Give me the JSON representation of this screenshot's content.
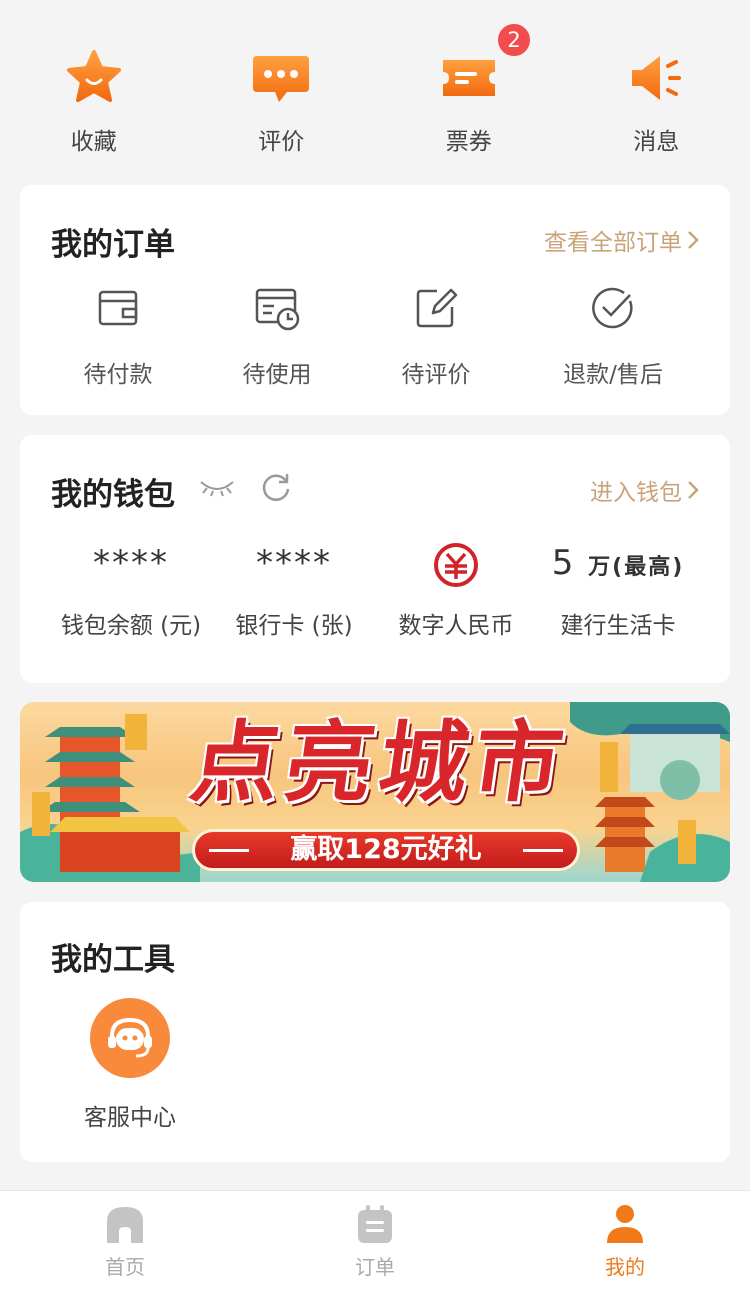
{
  "quick_actions": [
    {
      "label": "收藏",
      "icon": "star-icon"
    },
    {
      "label": "评价",
      "icon": "comment-icon"
    },
    {
      "label": "票券",
      "icon": "ticket-icon",
      "badge": "2"
    },
    {
      "label": "消息",
      "icon": "speaker-icon"
    }
  ],
  "orders": {
    "title": "我的订单",
    "view_all": "查看全部订单",
    "items": [
      {
        "label": "待付款",
        "icon": "wallet-icon"
      },
      {
        "label": "待使用",
        "icon": "calendar-clock-icon"
      },
      {
        "label": "待评价",
        "icon": "edit-icon"
      },
      {
        "label": "退款/售后",
        "icon": "check-circle-icon"
      }
    ]
  },
  "wallet": {
    "title": "我的钱包",
    "enter": "进入钱包",
    "items": [
      {
        "value": "****",
        "label": "钱包余额 (元)"
      },
      {
        "value": "****",
        "label": "银行卡 (张)"
      },
      {
        "value": "",
        "label": "数字人民币",
        "icon": "digital-rmb-icon"
      },
      {
        "value_num": "5",
        "value_unit": "万(最高)",
        "label": "建行生活卡"
      }
    ]
  },
  "banner": {
    "title": "点亮城市",
    "subtitle": "赢取128元好礼"
  },
  "tools": {
    "title": "我的工具",
    "items": [
      {
        "label": "客服中心",
        "icon": "customer-service-icon"
      }
    ]
  },
  "bottom_nav": {
    "items": [
      {
        "label": "首页",
        "icon": "home-icon",
        "active": false
      },
      {
        "label": "订单",
        "icon": "order-icon",
        "active": false
      },
      {
        "label": "我的",
        "icon": "profile-icon",
        "active": true
      }
    ]
  },
  "colors": {
    "accent": "#f07a1a",
    "link": "#c9a47a",
    "badge": "#f24d4d",
    "rmb_red": "#d0242a"
  }
}
